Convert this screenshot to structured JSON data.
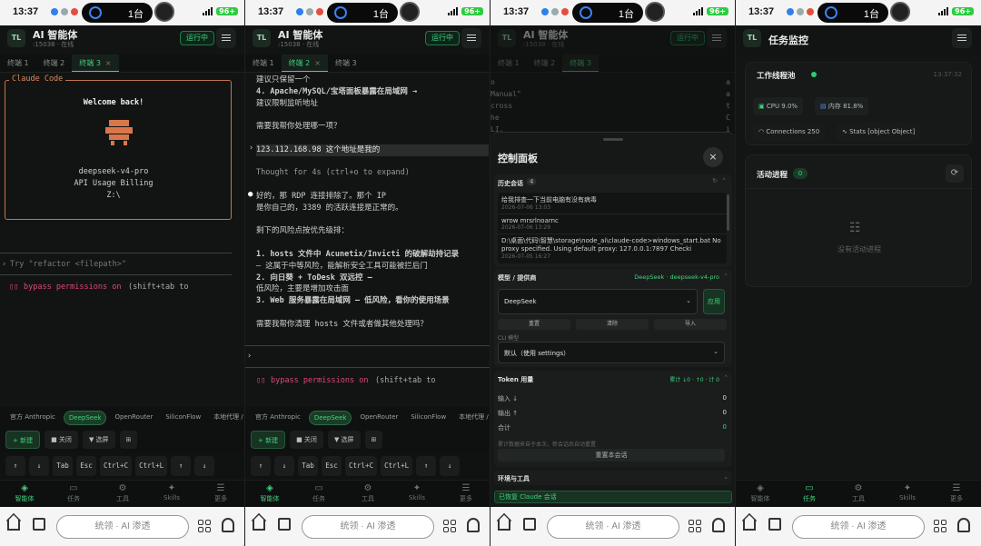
{
  "status": {
    "time": "13:37",
    "count": "1台",
    "battery": "96+"
  },
  "app": {
    "title": "AI 智能体",
    "subtitle": ":15038 · 在线",
    "run_badge": "运行中",
    "logo": "TL"
  },
  "tabs": [
    "终端 1",
    "终端 2",
    "终端 3"
  ],
  "pane1": {
    "box_title": "Claude Code",
    "welcome": "Welcome back!",
    "model": "deepseek-v4-pro",
    "billing": "API Usage Billing",
    "dir": "Z:\\",
    "prompt": "Try \"refactor <filepath>\"",
    "bypass": "bypass permissions on",
    "bypass_hint": "(shift+tab to"
  },
  "pane2": {
    "lines": [
      "建议只保留一个",
      "4. Apache/MySQL/宝塔面板暴露在局域网 →",
      "建议限制监听地址",
      "",
      "需要我帮你处理哪一项？",
      "",
      "123.112.168.98 这个地址是我的",
      "",
      "Thought for 4s (ctrl+o to expand)",
      "",
      "好的，那 RDP 连接排除了。那个 IP",
      "是你自己的，3389 的活跃连接是正常的。",
      "",
      "剩下的风险点按优先级排：",
      "",
      "1. hosts 文件中 Acunetix/Invicti 的破解劫持记录",
      "– 这属于中等风险，能解析安全工具可能被拦后门",
      "2. 向日葵 + ToDesk 双远控 –",
      "低风险，主要是增加攻击面",
      "3. Web 服务暴露在局域网 – 低风险，看你的使用场景",
      "",
      "需要我帮你清理 hosts 文件或者做其他处理吗？"
    ],
    "bypass": "bypass permissions on",
    "bypass_hint": "(shift+tab to"
  },
  "pane3": {
    "bg_lines": [
      "o",
      "Manual\"",
      "cross",
      "he",
      "LI,"
    ],
    "bg_right": [
      "a",
      "a",
      "t",
      "C",
      "i"
    ],
    "panel_title": "控制面板",
    "history_title": "历史会话",
    "history_count": "4",
    "history": [
      {
        "t": "给我排查一下当前电脑有没有病毒",
        "d": "2026-07-06 13:03"
      },
      {
        "t": "wrow mrsrlnoarnc",
        "d": "2026-07-06 13:29"
      },
      {
        "t": "D:\\桌面\\代码\\智慧\\storage\\node_ai\\claude-code>windows_start.bat No proxy specified. Using default proxy: 127.0.0.1:7897 Checki",
        "d": "2026-07-05 16:27"
      }
    ],
    "model_title": "模型 / 提供商",
    "model_tag": "DeepSeek · deepseek-v4-pro",
    "provider_value": "DeepSeek",
    "apply": "应用",
    "reset": "重置",
    "clear": "清除",
    "import": "导入",
    "cli_label": "CLI 模型",
    "cli_value": "默认（使用 settings）",
    "token_title": "Token 用量",
    "token_tag": "累计 ↓0 · ↑0 · 计 0",
    "token_rows": [
      {
        "k": "输入 ↓",
        "v": "0"
      },
      {
        "k": "输出 ↑",
        "v": "0"
      },
      {
        "k": "合计",
        "v": "0"
      }
    ],
    "token_note": "累计数据来自于本次，新会话后自动重置",
    "reset_session": "重置本会话",
    "env_title": "环境与工具",
    "footer": "已恢复 Claude 会话"
  },
  "monitor": {
    "title": "任务监控",
    "pool_title": "工作线程池",
    "pool_time": "13:37:32",
    "cpu": "CPU 9.0%",
    "mem": "内存 81.8%",
    "connections": "Connections 250",
    "stats": "Stats [object Object]",
    "proc_title": "活动进程",
    "proc_count": "0",
    "empty": "没有活动进程"
  },
  "providers": [
    "官方 Anthropic",
    "DeepSeek",
    "OpenRouter",
    "SiliconFlow",
    "本地代理 / 自"
  ],
  "actions": [
    "+ 新建",
    "■ 关闭",
    "▼ 选屏",
    "⊞"
  ],
  "keys": [
    "↑",
    "↓",
    "Tab",
    "Esc",
    "Ctrl+C",
    "Ctrl+L",
    "↑",
    "↓"
  ],
  "nav": [
    {
      "icon": "◈",
      "label": "智能体"
    },
    {
      "icon": "▭",
      "label": "任务"
    },
    {
      "icon": "⚙",
      "label": "工具"
    },
    {
      "icon": "✦",
      "label": "Skills"
    },
    {
      "icon": "☰",
      "label": "更多"
    }
  ],
  "browser": {
    "url": "统领 · AI 渗透"
  }
}
